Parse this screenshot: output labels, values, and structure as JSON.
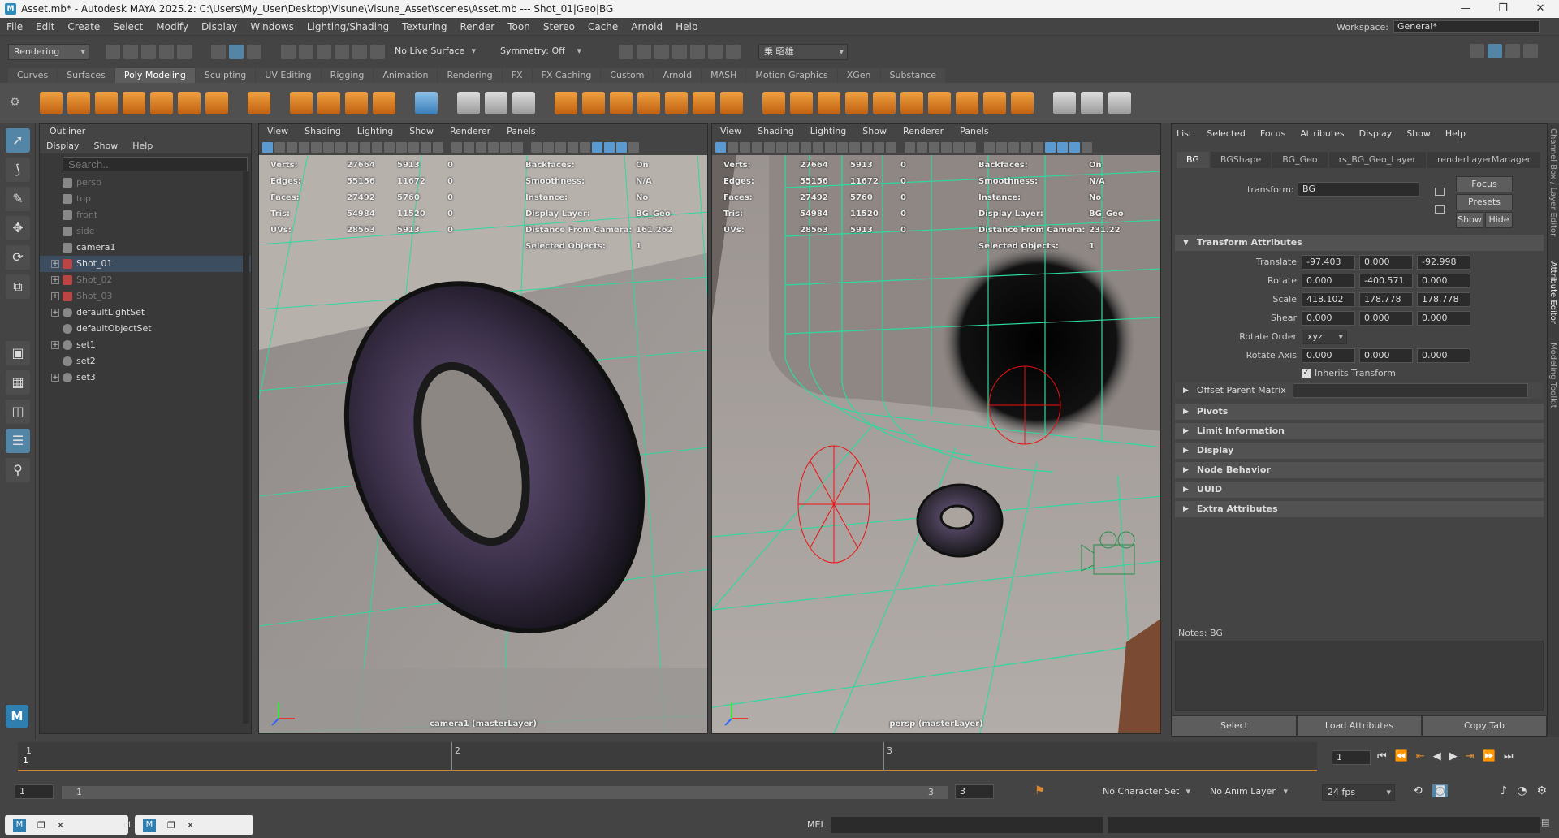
{
  "window": {
    "title": "Asset.mb* - Autodesk MAYA 2025.2: C:\\Users\\My_User\\Desktop\\Visune\\Visune_Asset\\scenes\\Asset.mb  ---  Shot_01|Geo|BG"
  },
  "menus": [
    "File",
    "Edit",
    "Create",
    "Select",
    "Modify",
    "Display",
    "Windows",
    "Lighting/Shading",
    "Texturing",
    "Render",
    "Toon",
    "Stereo",
    "Cache",
    "Arnold",
    "Help"
  ],
  "workspace": {
    "label": "Workspace:",
    "value": "General*"
  },
  "statusline": {
    "menuset": "Rendering",
    "live_surface": "No Live Surface",
    "symmetry": "Symmetry: Off",
    "user": "乗 昭雄"
  },
  "shelf_tabs": [
    "Curves",
    "Surfaces",
    "Poly Modeling",
    "Sculpting",
    "UV Editing",
    "Rigging",
    "Animation",
    "Rendering",
    "FX",
    "FX Caching",
    "Custom",
    "Arnold",
    "MASH",
    "Motion Graphics",
    "XGen",
    "Substance"
  ],
  "shelf_active": "Poly Modeling",
  "outliner": {
    "title": "Outliner",
    "menus": [
      "Display",
      "Show",
      "Help"
    ],
    "search_placeholder": "Search...",
    "items": [
      {
        "label": "persp",
        "dim": true,
        "exp": false,
        "indent": 1
      },
      {
        "label": "top",
        "dim": true,
        "exp": false,
        "indent": 1
      },
      {
        "label": "front",
        "dim": true,
        "exp": false,
        "indent": 1
      },
      {
        "label": "side",
        "dim": true,
        "exp": false,
        "indent": 1
      },
      {
        "label": "camera1",
        "dim": false,
        "exp": false,
        "indent": 1
      },
      {
        "label": "Shot_01",
        "dim": false,
        "exp": true,
        "sel": true
      },
      {
        "label": "Shot_02",
        "dim": true,
        "exp": true
      },
      {
        "label": "Shot_03",
        "dim": true,
        "exp": true
      },
      {
        "label": "defaultLightSet",
        "dim": false,
        "exp": true
      },
      {
        "label": "defaultObjectSet",
        "dim": false,
        "exp": false
      },
      {
        "label": "set1",
        "dim": false,
        "exp": true
      },
      {
        "label": "set2",
        "dim": false,
        "exp": false
      },
      {
        "label": "set3",
        "dim": false,
        "exp": true
      }
    ]
  },
  "viewport_menus": [
    "View",
    "Shading",
    "Lighting",
    "Show",
    "Renderer",
    "Panels"
  ],
  "viewport_left": {
    "label": "camera1 (masterLayer)",
    "hud_stats": [
      [
        "Verts:",
        "27664",
        "5913",
        "0"
      ],
      [
        "Edges:",
        "55156",
        "11672",
        "0"
      ],
      [
        "Faces:",
        "27492",
        "5760",
        "0"
      ],
      [
        "Tris:",
        "54984",
        "11520",
        "0"
      ],
      [
        "UVs:",
        "28563",
        "5913",
        "0"
      ]
    ],
    "hud_info": [
      [
        "Backfaces:",
        "On"
      ],
      [
        "Smoothness:",
        "N/A"
      ],
      [
        "Instance:",
        "No"
      ],
      [
        "Display Layer:",
        "BG_Geo"
      ],
      [
        "Distance From Camera:",
        "161.262"
      ],
      [
        "Selected Objects:",
        "1"
      ]
    ]
  },
  "viewport_right": {
    "label": "persp (masterLayer)",
    "hud_stats": [
      [
        "Verts:",
        "27664",
        "5913",
        "0"
      ],
      [
        "Edges:",
        "55156",
        "11672",
        "0"
      ],
      [
        "Faces:",
        "27492",
        "5760",
        "0"
      ],
      [
        "Tris:",
        "54984",
        "11520",
        "0"
      ],
      [
        "UVs:",
        "28563",
        "5913",
        "0"
      ]
    ],
    "hud_info": [
      [
        "Backfaces:",
        "On"
      ],
      [
        "Smoothness:",
        "N/A"
      ],
      [
        "Instance:",
        "No"
      ],
      [
        "Display Layer:",
        "BG_Geo"
      ],
      [
        "Distance From Camera:",
        "231.22"
      ],
      [
        "Selected Objects:",
        "1"
      ]
    ]
  },
  "attribute_editor": {
    "menus": [
      "List",
      "Selected",
      "Focus",
      "Attributes",
      "Display",
      "Show",
      "Help"
    ],
    "tabs": [
      "BG",
      "BGShape",
      "BG_Geo",
      "rs_BG_Geo_Layer",
      "renderLayerManager"
    ],
    "transform_label": "transform:",
    "transform_value": "BG",
    "buttons": {
      "focus": "Focus",
      "presets": "Presets",
      "show": "Show",
      "hide": "Hide"
    },
    "section_title": "Transform Attributes",
    "attrs": [
      {
        "label": "Translate",
        "values": [
          "-97.403",
          "0.000",
          "-92.998"
        ]
      },
      {
        "label": "Rotate",
        "values": [
          "0.000",
          "-400.571",
          "0.000"
        ]
      },
      {
        "label": "Scale",
        "values": [
          "418.102",
          "178.778",
          "178.778"
        ]
      },
      {
        "label": "Shear",
        "values": [
          "0.000",
          "0.000",
          "0.000"
        ]
      }
    ],
    "rotate_order_label": "Rotate Order",
    "rotate_order": "xyz",
    "rotate_axis": {
      "label": "Rotate Axis",
      "values": [
        "0.000",
        "0.000",
        "0.000"
      ]
    },
    "inherits": "Inherits Transform",
    "offset": "Offset Parent Matrix",
    "collapsed": [
      "Pivots",
      "Limit Information",
      "Display",
      "Node Behavior",
      "UUID",
      "Extra Attributes"
    ],
    "notes": "Notes:  BG",
    "bottom_buttons": [
      "Select",
      "Load Attributes",
      "Copy Tab"
    ]
  },
  "right_strip": [
    "Channel Box / Layer Editor",
    "Attribute Editor",
    "Modeling Toolkit"
  ],
  "timeslider": {
    "ticks": [
      "1",
      "2",
      "3"
    ],
    "current": "1"
  },
  "range": {
    "start": "1",
    "inner_start": "1",
    "inner_end": "3",
    "end": "3",
    "character_set": "No Character Set",
    "anim_layer": "No Anim Layer",
    "fps": "24 fps"
  },
  "cmd": {
    "mode": "MEL"
  },
  "taskbar": [
    "ct"
  ]
}
